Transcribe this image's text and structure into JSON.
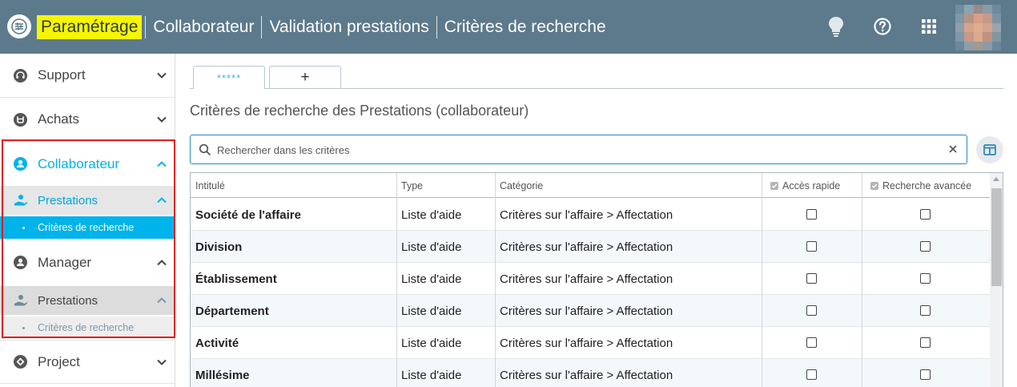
{
  "header": {
    "breadcrumbs": [
      "Paramétrage",
      "Collaborateur",
      "Validation prestations",
      "Critères de recherche"
    ],
    "icons": [
      "lightbulb-icon",
      "help-icon",
      "apps-grid-icon"
    ],
    "colors": {
      "bar": "#5d7a8c",
      "highlight": "#f6f600"
    }
  },
  "sidebar": {
    "items": [
      {
        "label": "Support",
        "icon": "headset-icon",
        "expanded": false
      },
      {
        "label": "Achats",
        "icon": "cart-icon",
        "expanded": false
      },
      {
        "label": "Collaborateur",
        "icon": "user-icon",
        "expanded": true,
        "active": true
      },
      {
        "label": "Manager",
        "icon": "user-icon",
        "expanded": true
      },
      {
        "label": "Project",
        "icon": "project-icon",
        "expanded": false
      }
    ],
    "collab_sub": {
      "label": "Prestations",
      "leaf": "Critères de recherche"
    },
    "manager_sub": {
      "label": "Prestations",
      "leaf": "Critères de recherche"
    },
    "colors": {
      "active": "#00b3ea",
      "active_bg": "#e6e6e6",
      "selected_leaf_bg": "#00b3ea"
    }
  },
  "tabs": [
    {
      "label": "*****",
      "active": true
    },
    {
      "label": "+",
      "active": false
    }
  ],
  "main": {
    "title": "Critères de recherche des Prestations (collaborateur)",
    "search_placeholder": "Rechercher dans les critères",
    "columns": [
      "Intitulé",
      "Type",
      "Catégorie",
      "Accès rapide",
      "Recherche avancée"
    ],
    "rows": [
      {
        "intitule": "Société de l'affaire",
        "type": "Liste d'aide",
        "categorie": "Critères sur l'affaire > Affectation",
        "acces_rapide": false,
        "recherche_avancee": false
      },
      {
        "intitule": "Division",
        "type": "Liste d'aide",
        "categorie": "Critères sur l'affaire > Affectation",
        "acces_rapide": false,
        "recherche_avancee": false
      },
      {
        "intitule": "Établissement",
        "type": "Liste d'aide",
        "categorie": "Critères sur l'affaire > Affectation",
        "acces_rapide": false,
        "recherche_avancee": false
      },
      {
        "intitule": "Département",
        "type": "Liste d'aide",
        "categorie": "Critères sur l'affaire > Affectation",
        "acces_rapide": false,
        "recherche_avancee": false
      },
      {
        "intitule": "Activité",
        "type": "Liste d'aide",
        "categorie": "Critères sur l'affaire > Affectation",
        "acces_rapide": false,
        "recherche_avancee": false
      },
      {
        "intitule": "Millésime",
        "type": "Liste d'aide",
        "categorie": "Critères sur l'affaire > Affectation",
        "acces_rapide": false,
        "recherche_avancee": false
      }
    ]
  }
}
